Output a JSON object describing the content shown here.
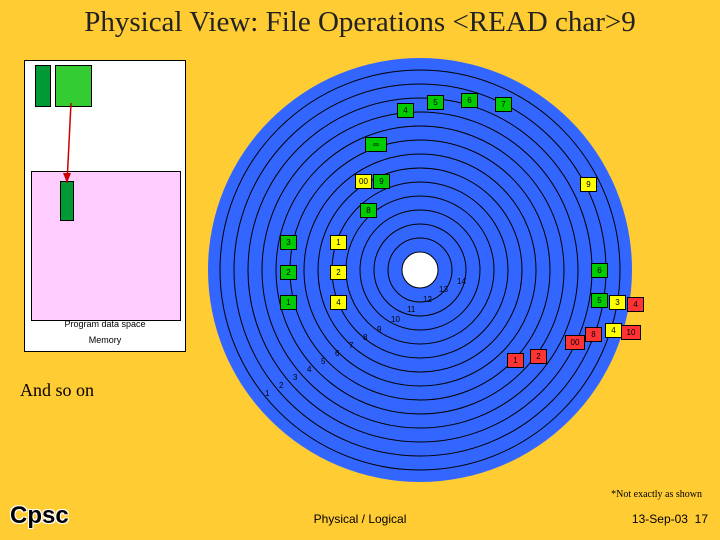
{
  "title": "Physical View: File Operations <READ char>9",
  "memory": {
    "data_space_label": "Program data space",
    "memory_label": "Memory"
  },
  "and_so_on": "And so on",
  "note": "*Not exactly as shown",
  "footer_center": "Physical / Logical",
  "footer_date": "13-Sep-03",
  "footer_page": "17",
  "logo": "Cpsc",
  "disk_top": {
    "n4": "4",
    "n5": "5",
    "n6": "6",
    "n7": "7",
    "infinity": "∞",
    "n8": "8",
    "n00": "00",
    "n9": "9"
  },
  "disk_left": {
    "g3": "3",
    "g2": "2",
    "g1": "1",
    "y1": "1",
    "y2": "2",
    "y4": "4"
  },
  "disk_right": {
    "g6": "6",
    "g5": "5",
    "y3": "3",
    "y4": "4",
    "r4": "4",
    "r10": "10"
  },
  "disk_bottom": {
    "r1": "1",
    "r2": "2",
    "r00": "00",
    "r8": "8"
  },
  "ringlabels": [
    "1",
    "2",
    "3",
    "4",
    "5",
    "6",
    "7",
    "8",
    "9",
    "10",
    "11",
    "12",
    "13",
    "14"
  ]
}
